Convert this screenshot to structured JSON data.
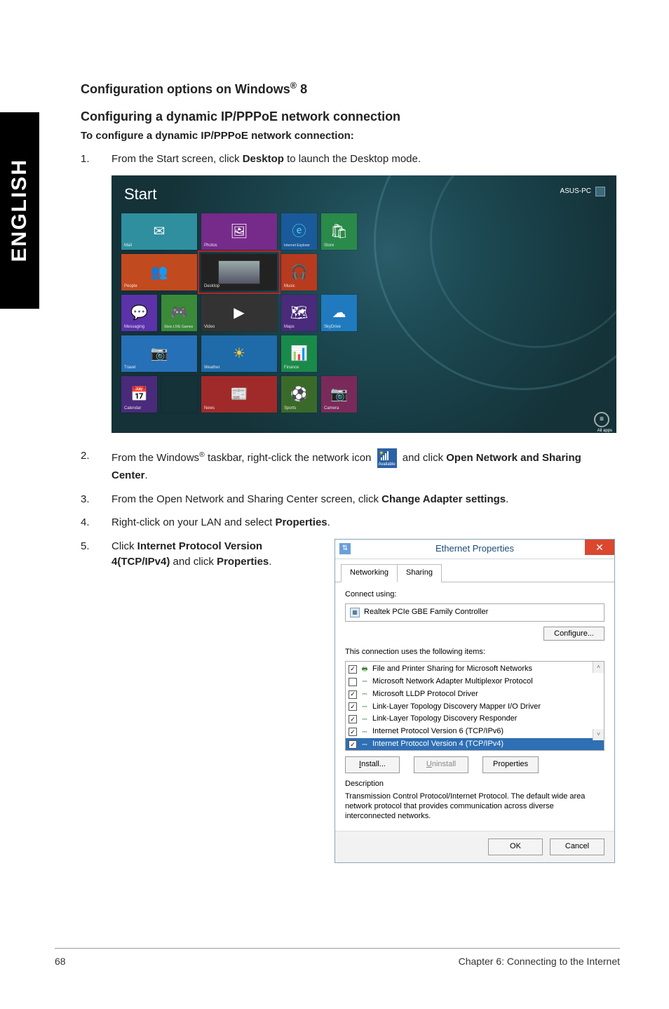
{
  "side_tab": "ENGLISH",
  "headings": {
    "config_options_prefix": "Configuration options on Windows",
    "reg": "®",
    "config_options_suffix": " 8",
    "config_dynamic": "Configuring a dynamic IP/PPPoE network connection",
    "sub_to_configure": "To configure a dynamic IP/PPPoE network connection:"
  },
  "steps": {
    "s1": {
      "num": "1.",
      "pre": "From the Start screen, click ",
      "bold": "Desktop",
      "post": " to launch the Desktop mode."
    },
    "s2": {
      "num": "2.",
      "pre": "From the Windows",
      "reg": "®",
      "mid1": " taskbar, right-click the network icon ",
      "mid2": " and click ",
      "bold1": "Open Network and Sharing Center",
      "post": "."
    },
    "s3": {
      "num": "3.",
      "pre": "From the Open Network and Sharing Center screen, click ",
      "bold": "Change Adapter settings",
      "post": "."
    },
    "s4": {
      "num": "4.",
      "pre": "Right-click on your LAN and select ",
      "bold": "Properties",
      "post": "."
    },
    "s5": {
      "num": "5.",
      "pre": "Click ",
      "bold1": "Internet Protocol Version 4(TCP/IPv4)",
      "mid": " and click ",
      "bold2": "Properties",
      "post": "."
    }
  },
  "start_screen": {
    "title": "Start",
    "user": "ASUS-PC",
    "allapps": "All apps",
    "tiles": {
      "mail": "Mail",
      "people": "People",
      "messaging": "Messaging",
      "xbox": "Xbox LIVE Games",
      "travel": "Travel",
      "calendar": "Calendar",
      "photos": "Photos",
      "desktop": "Desktop",
      "video": "Video",
      "weather": "Weather",
      "news": "News",
      "ie": "Internet Explorer",
      "music": "Music",
      "maps": "Maps",
      "finance": "Finance",
      "sports": "Sports",
      "store": "Store",
      "skydrive": "SkyDrive",
      "camera": "Camera"
    }
  },
  "tray": {
    "available": "Available"
  },
  "dialog": {
    "title": "Ethernet Properties",
    "tabs": {
      "networking": "Networking",
      "sharing": "Sharing"
    },
    "connect_using": "Connect using:",
    "adapter": "Realtek PCIe GBE Family Controller",
    "configure": "Configure...",
    "uses_items": "This connection uses the following items:",
    "items": [
      {
        "checked": true,
        "icon": "share",
        "label": "File and Printer Sharing for Microsoft Networks"
      },
      {
        "checked": false,
        "icon": "proto",
        "label": "Microsoft Network Adapter Multiplexor Protocol"
      },
      {
        "checked": true,
        "icon": "proto",
        "label": "Microsoft LLDP Protocol Driver"
      },
      {
        "checked": true,
        "icon": "proto",
        "label": "Link-Layer Topology Discovery Mapper I/O Driver"
      },
      {
        "checked": true,
        "icon": "proto",
        "label": "Link-Layer Topology Discovery Responder"
      },
      {
        "checked": true,
        "icon": "proto",
        "label": "Internet Protocol Version 6 (TCP/IPv6)"
      },
      {
        "checked": true,
        "icon": "proto",
        "label": "Internet Protocol Version 4 (TCP/IPv4)",
        "selected": true
      }
    ],
    "install": "Install...",
    "uninstall": "Uninstall",
    "properties": "Properties",
    "description_hdr": "Description",
    "description": "Transmission Control Protocol/Internet Protocol. The default wide area network protocol that provides communication across diverse interconnected networks.",
    "ok": "OK",
    "cancel": "Cancel"
  },
  "footer": {
    "page": "68",
    "chapter": "Chapter 6: Connecting to the Internet"
  }
}
